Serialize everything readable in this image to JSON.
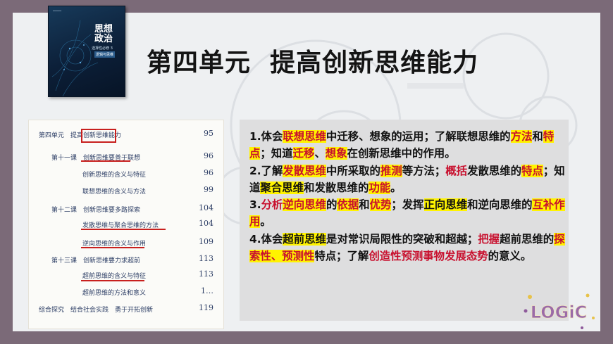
{
  "title": "第四单元  提高创新思维能力",
  "book": {
    "title_line1": "思想",
    "title_line2": "政治",
    "subtitle": "选择性必修 3",
    "tag": "逻辑与思维"
  },
  "toc": {
    "rows": [
      {
        "text": "第四单元　提高创新思维能力",
        "page": "95",
        "indent": 0
      },
      {
        "text": "第十一课　创新思维要善于联想",
        "page": "96",
        "indent": 1
      },
      {
        "text": "创新思维的含义与特征",
        "page": "96",
        "indent": 2
      },
      {
        "text": "联想思维的含义与方法",
        "page": "99",
        "indent": 2
      },
      {
        "text": "第十二课　创新思维要多路探索",
        "page": "104",
        "indent": 1
      },
      {
        "text": "发散思维与聚合思维的方法",
        "page": "104",
        "indent": 2
      },
      {
        "text": "逆向思维的含义与作用",
        "page": "109",
        "indent": 2
      },
      {
        "text": "第十三课　创新思维要力求超前",
        "page": "113",
        "indent": 1
      },
      {
        "text": "超前思维的含义与特征",
        "page": "113",
        "indent": 2
      },
      {
        "text": "超前思维的方法和意义",
        "page": "1…",
        "indent": 2
      },
      {
        "text": "综合探究　结合社会实践　勇于开拓创新",
        "page": "119",
        "indent": 0
      }
    ]
  },
  "points": [
    {
      "segments": [
        {
          "t": "1.体会",
          "s": "n"
        },
        {
          "t": "联想思维",
          "s": "hl"
        },
        {
          "t": "中迁移、想象的运用；了解联想思维的",
          "s": "n"
        },
        {
          "t": "方法",
          "s": "hl"
        },
        {
          "t": "和",
          "s": "n"
        },
        {
          "t": "特点",
          "s": "hl"
        },
        {
          "t": "；知道",
          "s": "n"
        },
        {
          "t": "迁移",
          "s": "hl"
        },
        {
          "t": "、",
          "s": "n"
        },
        {
          "t": "想象",
          "s": "hl"
        },
        {
          "t": "在创新思维中的作用。",
          "s": "n"
        }
      ]
    },
    {
      "segments": [
        {
          "t": "2.了解",
          "s": "n"
        },
        {
          "t": "发散思维",
          "s": "hl"
        },
        {
          "t": "中所采取的",
          "s": "n"
        },
        {
          "t": "推测",
          "s": "hl"
        },
        {
          "t": "等方法；",
          "s": "n"
        },
        {
          "t": "概括",
          "s": "red"
        },
        {
          "t": "发散思维的",
          "s": "n"
        },
        {
          "t": "特点",
          "s": "hl"
        },
        {
          "t": "；知道",
          "s": "n"
        },
        {
          "t": "聚合思维",
          "s": "hy"
        },
        {
          "t": "和发散思维的",
          "s": "n"
        },
        {
          "t": "功能",
          "s": "hl"
        },
        {
          "t": "。",
          "s": "n"
        }
      ]
    },
    {
      "segments": [
        {
          "t": "3.",
          "s": "n"
        },
        {
          "t": "分析",
          "s": "red"
        },
        {
          "t": "逆向思维",
          "s": "hl"
        },
        {
          "t": "的",
          "s": "n"
        },
        {
          "t": "依据",
          "s": "hl"
        },
        {
          "t": "和",
          "s": "n"
        },
        {
          "t": "优势",
          "s": "hl"
        },
        {
          "t": "；发挥",
          "s": "n"
        },
        {
          "t": "正向思维",
          "s": "hy"
        },
        {
          "t": "和逆向思维的",
          "s": "n"
        },
        {
          "t": "互补作用",
          "s": "hl"
        },
        {
          "t": "。",
          "s": "n"
        }
      ]
    },
    {
      "segments": [
        {
          "t": "4.体会",
          "s": "n"
        },
        {
          "t": "超前思维",
          "s": "hy"
        },
        {
          "t": "是对常识局限性的突破和超越；",
          "s": "n"
        },
        {
          "t": "把握",
          "s": "red"
        },
        {
          "t": "超前思维的",
          "s": "n"
        },
        {
          "t": "探索性、预测性",
          "s": "hl"
        },
        {
          "t": "特点；了解",
          "s": "n"
        },
        {
          "t": "创造性预测事物发展态势",
          "s": "red"
        },
        {
          "t": "的意义。",
          "s": "n"
        }
      ]
    }
  ],
  "logo": {
    "text": "LOGiC"
  },
  "colors": {
    "accent": "#c8102e",
    "highlight": "#fff300",
    "frame": "#7b6a78"
  }
}
